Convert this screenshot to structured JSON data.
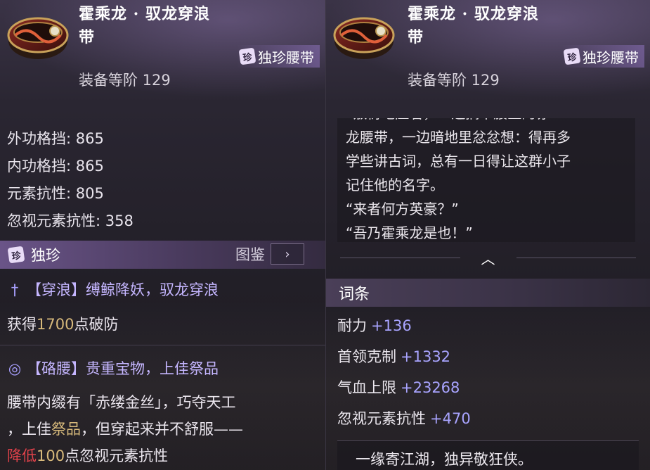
{
  "left": {
    "item_name": "霍乘龙 · 驭龙穿浪带",
    "item_type": "独珍腰带",
    "gem_glyph": "珍",
    "tier": "装备等阶 129",
    "stats": [
      "外功格挡: 865",
      "内功格挡: 865",
      "元素抗性: 805",
      "忽视元素抗性: 358"
    ],
    "rarity": "独珍",
    "codex_label": "图鉴",
    "codex_icon": "arrow-right-icon",
    "skill1_title": "【穿浪】缚鲸降妖，驭龙穿浪",
    "skill1_prefix": "获得",
    "skill1_value": "1700",
    "skill1_suffix": "点破防",
    "skill2_title": "【硌腰】贵重宝物，上佳祭品",
    "skill2_line1": "腰带内缀有「赤缕金丝」，巧夺天工",
    "skill2_line2_a": "，上佳",
    "skill2_line2_b": "祭品",
    "skill2_line2_c": "，但穿起来并不舒服——",
    "skill2_line3_a": "降低",
    "skill2_line3_b": "100",
    "skill2_line3_c": "点忽视元素抗性",
    "accent_color": "#c5b6ff",
    "gold_color": "#d7b97b",
    "red_color": "#e0424a"
  },
  "right": {
    "item_name": "霍乘龙 · 驭龙穿浪带",
    "item_type": "独珍腰带",
    "tier": "装备等阶 129",
    "lore": [
      "“敷衍地应着，一边摘下腰上的赤",
      "龙腰带，一边暗地里忿忿想：得再多",
      "学些讲古词，总有一日得让这群小子",
      "记住他的名字。",
      "“来者何方英豪？”",
      "“吾乃霍乘龙是也！”"
    ],
    "collapse_icon": "chevron-up-icon",
    "affix_header": "词条",
    "affixes": [
      {
        "name": "耐力",
        "value": "+136"
      },
      {
        "name": "首领克制",
        "value": "+1332"
      },
      {
        "name": "气血上限",
        "value": "+23268"
      },
      {
        "name": "忽视元素抗性",
        "value": "+470"
      }
    ],
    "motto": "一缘寄江湖，独异敬狂侠。"
  }
}
